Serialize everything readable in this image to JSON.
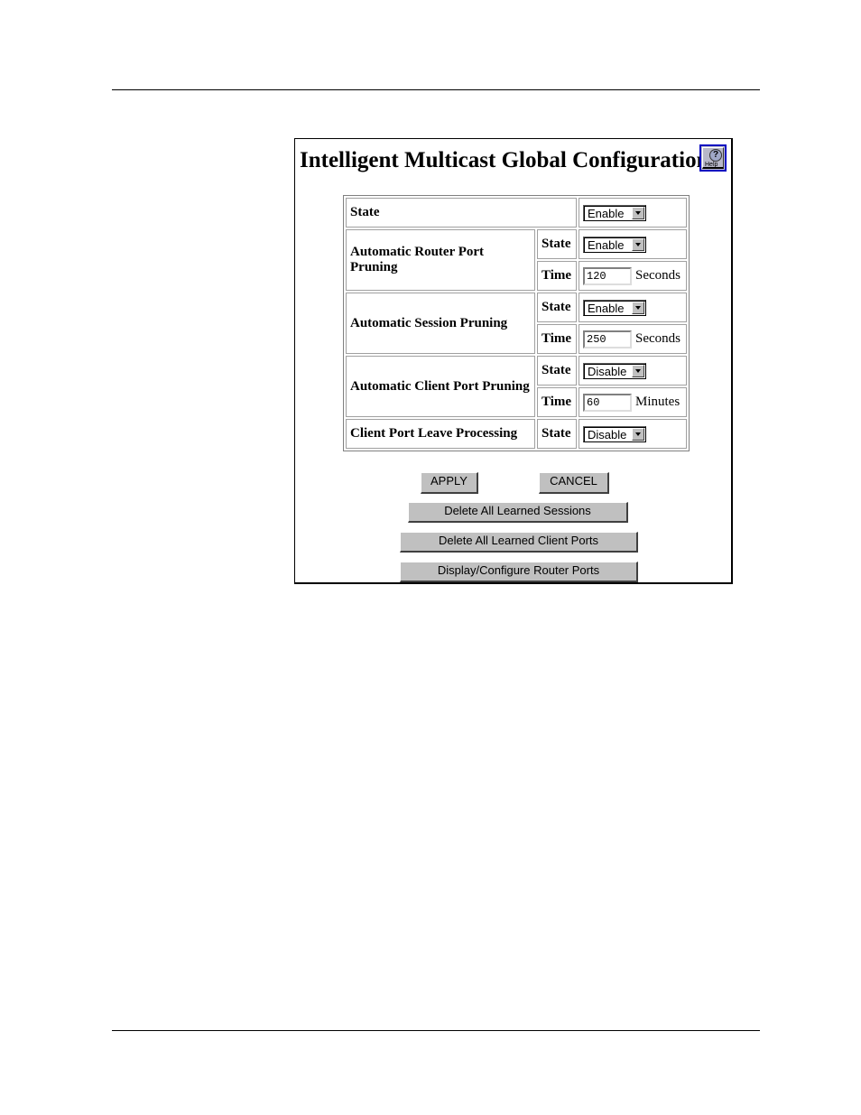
{
  "page": {
    "title": "Intelligent Multicast Global Configuration",
    "help_label": "Help",
    "help_icon": "question-mark-icon"
  },
  "form": {
    "global_state": {
      "label": "State",
      "value": "Enable"
    },
    "rows": [
      {
        "label": "Automatic Router Port Pruning",
        "state_label": "State",
        "state_value": "Enable",
        "time_label": "Time",
        "time_value": "120",
        "time_unit": "Seconds"
      },
      {
        "label": "Automatic Session Pruning",
        "state_label": "State",
        "state_value": "Enable",
        "time_label": "Time",
        "time_value": "250",
        "time_unit": "Seconds"
      },
      {
        "label": "Automatic Client Port Pruning",
        "state_label": "State",
        "state_value": "Disable",
        "time_label": "Time",
        "time_value": "60",
        "time_unit": "Minutes"
      }
    ],
    "leave": {
      "label": "Client Port Leave Processing",
      "state_label": "State",
      "state_value": "Disable"
    }
  },
  "buttons": {
    "apply": "APPLY",
    "cancel": "CANCEL",
    "delete_sessions": "Delete All Learned Sessions",
    "delete_client_ports": "Delete All Learned Client Ports",
    "router_ports": "Display/Configure Router Ports"
  }
}
